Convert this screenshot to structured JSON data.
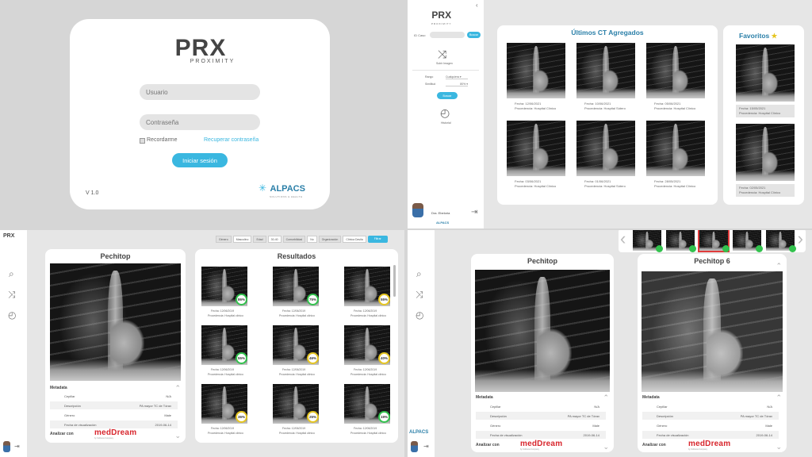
{
  "login": {
    "logo_text": "PRX",
    "logo_sub": "PROXIMITY",
    "user_placeholder": "Usuario",
    "pass_placeholder": "Contraseña",
    "remember": "Recordarme",
    "recover": "Recuperar contraseña",
    "submit": "Iniciar sesión",
    "version": "V 1.0",
    "brand": "ALPACS",
    "brand_sub": "SOLUTIONS & HEALTH"
  },
  "dashboard": {
    "logo_text": "PRX",
    "logo_sub": "PROXIMITY",
    "id_label": "ID Caso",
    "search_btn": "Buscar",
    "ia_label": "Subir Imagen",
    "filter1_label": "Rango",
    "filter1_value": "Cualquiera ▾",
    "filter2_label": "Similitud",
    "filter2_value": "80% ▾",
    "filter_btn": "Buscar",
    "history_label": "Historial",
    "user_name": "Dra. Ebeloria",
    "brand": "ALPACS",
    "recent_title": "Últimos CT Agregados",
    "recent": [
      {
        "date": "Fecha: 12/06/2021",
        "place": "Procedencia: Hospital Clínico"
      },
      {
        "date": "Fecha: 10/06/2021",
        "place": "Procedencia: Hospital Sótero"
      },
      {
        "date": "Fecha: 05/06/2021",
        "place": "Procedencia: Hospital Clínico"
      },
      {
        "date": "Fecha: 03/06/2021",
        "place": "Procedencia: Hospital Clínico"
      },
      {
        "date": "Fecha: 01/06/2021",
        "place": "Procedencia: Hospital Sótero"
      },
      {
        "date": "Fecha: 28/05/2021",
        "place": "Procedencia: Hospital Clínico"
      }
    ],
    "favorites_title": "Favoritos",
    "favorites": [
      {
        "date": "Fecha: 15/05/2021",
        "place": "Procedencia: Hospital Clínico"
      },
      {
        "date": "Fecha: 02/05/2021",
        "place": "Procedencia: Hospital Clínico"
      }
    ]
  },
  "results": {
    "logo_text": "PRX",
    "filters": [
      "Género",
      "Masculino",
      "Edad",
      "30-40",
      "Comorbilidad",
      "No",
      "Organización",
      "Clínica Davila"
    ],
    "filter_btn": "Filtrar",
    "query_title": "Pechitop",
    "metadata_title": "Metadata",
    "metadata": [
      {
        "k": "Cepillar",
        "v": "N/A"
      },
      {
        "k": "Descripción",
        "v": "PA mayor TC de Tórax"
      },
      {
        "k": "Género",
        "v": "Male"
      },
      {
        "k": "Fecha de visualización",
        "v": "2019-06-14"
      }
    ],
    "analyze": "Analizar con",
    "medream": "medDream",
    "medream_sub": "by Softneta Company",
    "results_title": "Resultados",
    "items": [
      {
        "pct": "86%",
        "date": "Fecha: 12/06/2019",
        "place": "Procedencia: Hospital clínico"
      },
      {
        "pct": "75%",
        "date": "Fecha: 12/06/2019",
        "place": "Procedencia: Hospital clínico"
      },
      {
        "pct": "55%",
        "date": "Fecha: 12/06/2019",
        "place": "Procedencia: Hospital clínico"
      },
      {
        "pct": "55%",
        "date": "Fecha: 12/06/2019",
        "place": "Procedencia: Hospital clínico"
      },
      {
        "pct": "46%",
        "date": "Fecha: 12/06/2019",
        "place": "Procedencia: Hospital clínico"
      },
      {
        "pct": "40%",
        "date": "Fecha: 12/06/2019",
        "place": "Procedencia: Hospital clínico"
      },
      {
        "pct": "36%",
        "date": "Fecha: 12/06/2019",
        "place": "Procedencia: Hospital clínico"
      },
      {
        "pct": "25%",
        "date": "Fecha: 12/06/2019",
        "place": "Procedencia: Hospital clínico"
      },
      {
        "pct": "19%",
        "date": "Fecha: 12/06/2019",
        "place": "Procedencia: Hospital clínico"
      }
    ]
  },
  "compare": {
    "left_title": "Pechitop",
    "right_title": "Pechitop 6",
    "metadata_title": "Metadata",
    "analyze": "Analizar con",
    "medream": "medDream",
    "medream_sub": "by Softneta Company",
    "brand": "ALPACS",
    "metadata": [
      {
        "k": "Cepillar",
        "v": "N/A"
      },
      {
        "k": "Descripción",
        "v": "PA mayor TC de Tórax"
      },
      {
        "k": "Género",
        "v": "Male"
      },
      {
        "k": "Fecha de visualización",
        "v": "2019-06-14"
      }
    ]
  },
  "colors": {
    "accent": "#3ab7e0",
    "success": "#32c24d",
    "warning": "#e5c520",
    "brand_red": "#d8262d"
  }
}
